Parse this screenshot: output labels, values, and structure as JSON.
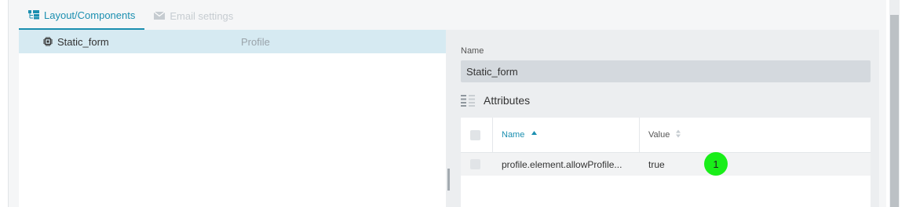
{
  "tabs": [
    {
      "label": "Layout/Components",
      "icon": "tree-structure-icon",
      "active": true
    },
    {
      "label": "Email settings",
      "icon": "envelope-icon",
      "active": false
    }
  ],
  "tree": {
    "selected_item": {
      "label": "Static_form",
      "type": "Profile",
      "icon": "chip-icon"
    }
  },
  "details": {
    "name_label": "Name",
    "name_value": "Static_form",
    "attributes_title": "Attributes",
    "table": {
      "columns": [
        "Name",
        "Value"
      ],
      "rows": [
        {
          "name": "profile.element.allowProfile...",
          "value": "true"
        }
      ]
    }
  },
  "marker": {
    "label": "1",
    "color": "#19ee19"
  },
  "colors": {
    "accent": "#1b8fb0",
    "selected_row": "#d6eaf2"
  }
}
